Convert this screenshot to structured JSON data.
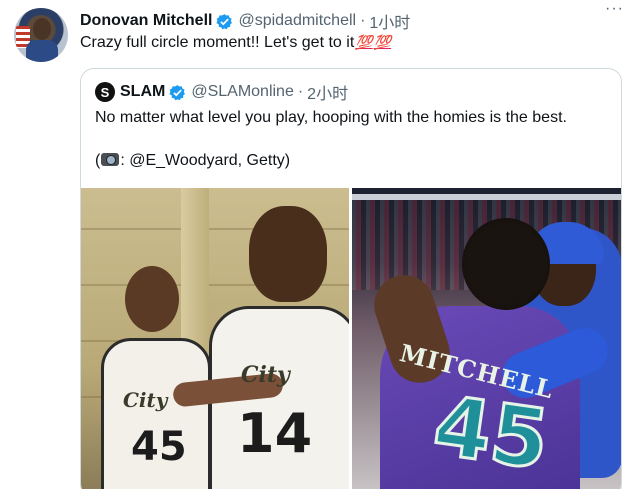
{
  "tweet": {
    "author_name": "Donovan Mitchell",
    "author_handle": "@spidadmitchell",
    "separator": "·",
    "time": "1小时",
    "more": "···",
    "text": "Crazy full circle moment!! Let's get to it",
    "emoji": [
      "💯",
      "💯"
    ]
  },
  "quoted": {
    "logo_letter": "S",
    "author_name": "SLAM",
    "author_handle": "@SLAMonline",
    "separator": "·",
    "time": "2小时",
    "text_line1": "No matter what level you play, hooping with the homies is the best.",
    "credit_prefix": "(",
    "credit_text": ": @E_Woodyard, Getty)",
    "photos": {
      "left": {
        "jersey_city": "City",
        "kid1_number": "45",
        "kid2_number": "14"
      },
      "right": {
        "jersey_name": "MITCHELL",
        "jersey_number": "45"
      }
    }
  },
  "colors": {
    "verified_blue": "#1d9bf0",
    "secondary_text": "#536471",
    "hundred_red": "#e0245e"
  }
}
